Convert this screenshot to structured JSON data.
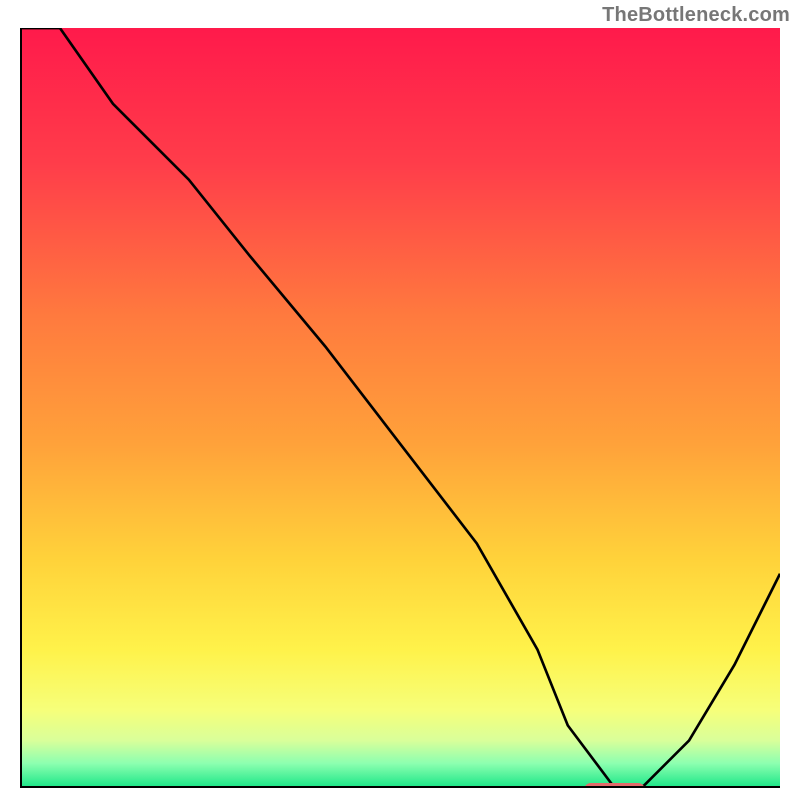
{
  "watermark": "TheBottleneck.com",
  "chart_data": {
    "type": "line",
    "title": "",
    "xlabel": "",
    "ylabel": "",
    "xlim": [
      0,
      100
    ],
    "ylim": [
      0,
      100
    ],
    "x": [
      0,
      5,
      12,
      22,
      30,
      40,
      50,
      60,
      68,
      72,
      78,
      82,
      88,
      94,
      100
    ],
    "values": [
      108,
      100,
      90,
      80,
      70,
      58,
      45,
      32,
      18,
      8,
      0,
      0,
      6,
      16,
      28
    ],
    "marker": {
      "x_start": 74,
      "x_end": 82,
      "y": 0
    },
    "gradient_stops": [
      {
        "offset": 0,
        "color": "#ff1a4b"
      },
      {
        "offset": 18,
        "color": "#ff3d4a"
      },
      {
        "offset": 38,
        "color": "#ff7a3e"
      },
      {
        "offset": 55,
        "color": "#ffa23a"
      },
      {
        "offset": 70,
        "color": "#ffd23a"
      },
      {
        "offset": 82,
        "color": "#fff24a"
      },
      {
        "offset": 90,
        "color": "#f6ff7a"
      },
      {
        "offset": 94,
        "color": "#d9ff9a"
      },
      {
        "offset": 97,
        "color": "#8dffb0"
      },
      {
        "offset": 100,
        "color": "#22e88a"
      }
    ]
  }
}
